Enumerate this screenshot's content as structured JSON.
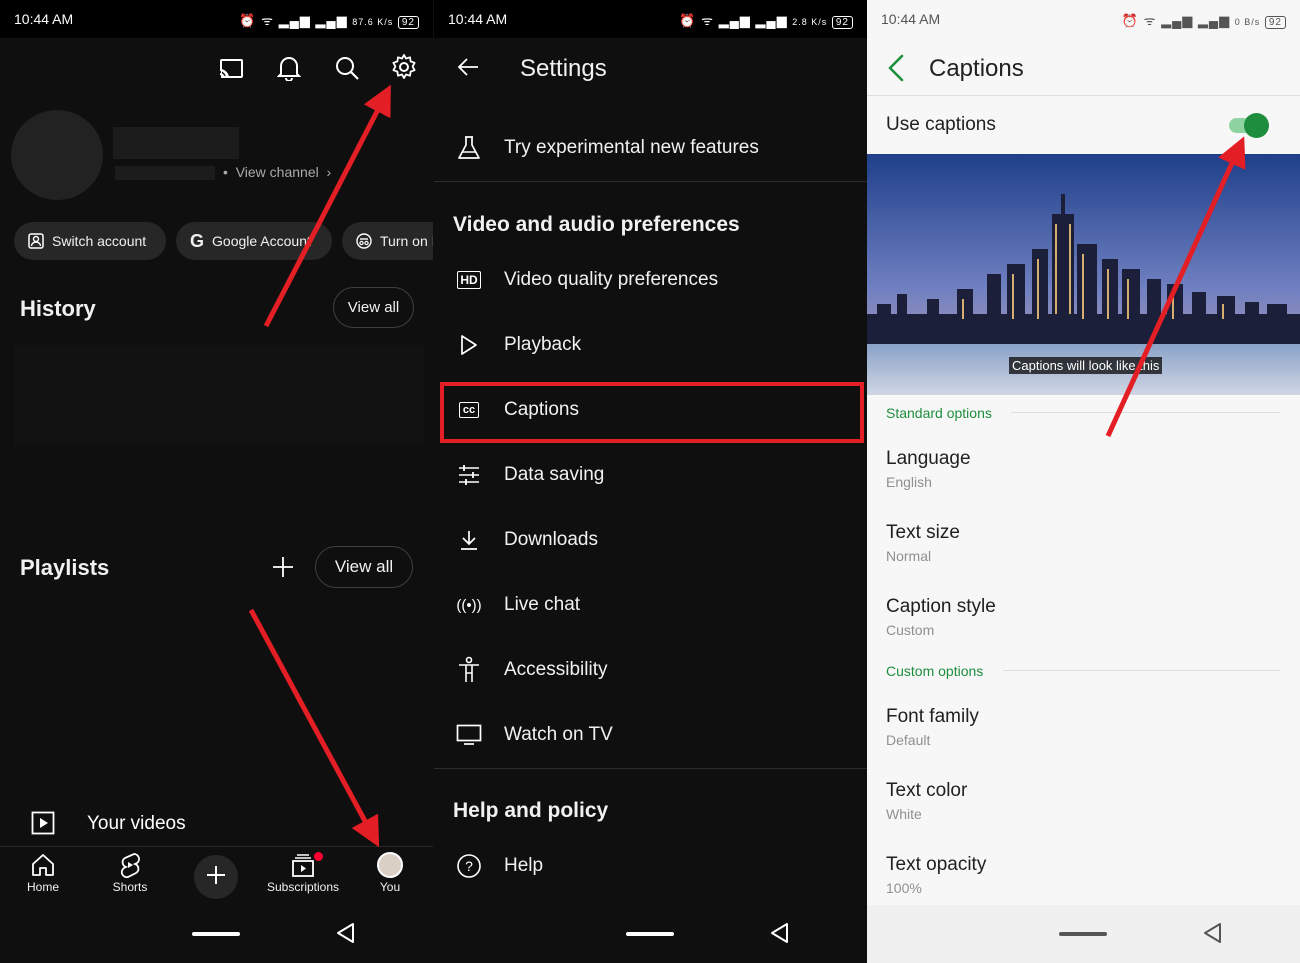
{
  "status_bar": {
    "time": "10:44 AM",
    "p1_speed": "87.6 K/s",
    "p2_speed": "2.8 K/s",
    "p3_speed": "0 B/s",
    "battery": "92"
  },
  "you_screen": {
    "view_channel": "View channel",
    "chips": [
      "Switch account",
      "Google Account",
      "Turn on I"
    ],
    "history_title": "History",
    "history_view_all": "View all",
    "playlists_title": "Playlists",
    "playlists_view_all": "View all",
    "your_videos": "Your videos",
    "nav": {
      "home": "Home",
      "shorts": "Shorts",
      "subscriptions": "Subscriptions",
      "you": "You"
    }
  },
  "settings_screen": {
    "title": "Settings",
    "experimental": "Try experimental new features",
    "video_audio_header": "Video and audio preferences",
    "items": {
      "video_quality": "Video quality preferences",
      "playback": "Playback",
      "captions": "Captions",
      "data_saving": "Data saving",
      "downloads": "Downloads",
      "live_chat": "Live chat",
      "accessibility": "Accessibility",
      "watch_on_tv": "Watch on TV"
    },
    "help_header": "Help and policy",
    "help": "Help",
    "hd_badge": "HD",
    "cc_badge": "cc"
  },
  "captions_screen": {
    "title": "Captions",
    "use_captions": "Use captions",
    "use_captions_on": true,
    "preview_caption": "Captions will look like this",
    "standard_options": "Standard options",
    "language": {
      "label": "Language",
      "value": "English"
    },
    "text_size": {
      "label": "Text size",
      "value": "Normal"
    },
    "caption_style": {
      "label": "Caption style",
      "value": "Custom"
    },
    "custom_options": "Custom options",
    "font_family": {
      "label": "Font family",
      "value": "Default"
    },
    "text_color": {
      "label": "Text color",
      "value": "White"
    },
    "text_opacity": {
      "label": "Text opacity",
      "value": "100%"
    }
  },
  "colors": {
    "dark_bg": "#0f0f0f",
    "light_bg": "#f7f7f7",
    "accent_green": "#1e8e3e",
    "highlight_red": "#e31e24"
  }
}
